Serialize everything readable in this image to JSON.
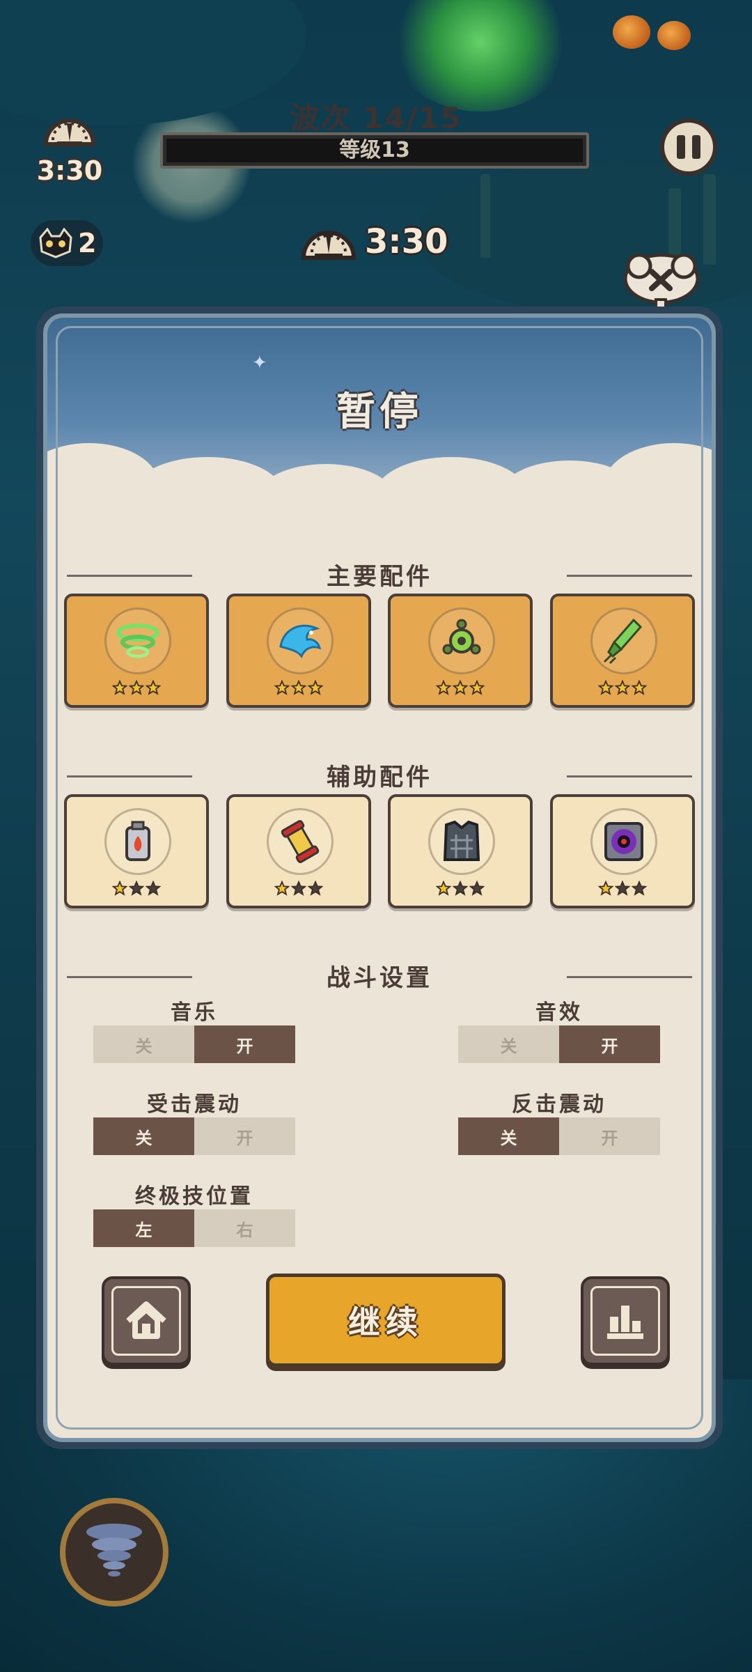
{
  "hud": {
    "speed_time": "3:30",
    "lives_count": "2",
    "wave_label": "波次  14/15",
    "level_label": "等级13",
    "center_time": "3:30"
  },
  "panel": {
    "title": "暂停",
    "main_parts_label": "主要配件",
    "aux_parts_label": "辅助配件",
    "battle_settings_label": "战斗设置",
    "main_parts": [
      {
        "name": "green-whirlwind-icon",
        "stars": 3
      },
      {
        "name": "blue-dragon-icon",
        "stars": 3
      },
      {
        "name": "green-orb-drone-icon",
        "stars": 3
      },
      {
        "name": "green-rocket-icon",
        "stars": 3
      }
    ],
    "aux_parts": [
      {
        "name": "fire-fuel-flask-icon",
        "stars": 1
      },
      {
        "name": "red-scroll-canister-icon",
        "stars": 1
      },
      {
        "name": "armor-vest-icon",
        "stars": 1
      },
      {
        "name": "black-hole-device-icon",
        "stars": 1
      }
    ],
    "colors": {
      "star_filled": "#f4c22c",
      "star_empty": "#4a3f3a",
      "main_card": "#e5a74f",
      "aux_card": "#f4e3bd",
      "continue_button": "#e7a52a"
    }
  },
  "settings": {
    "music": {
      "title": "音乐",
      "off": "关",
      "on": "开",
      "value": "开"
    },
    "sfx": {
      "title": "音效",
      "off": "关",
      "on": "开",
      "value": "开"
    },
    "hit_vibration": {
      "title": "受击震动",
      "off": "关",
      "on": "开",
      "value": "关"
    },
    "counter_vibration": {
      "title": "反击震动",
      "off": "关",
      "on": "开",
      "value": "关"
    },
    "ultimate_position": {
      "title": "终极技位置",
      "left": "左",
      "right": "右",
      "value": "左"
    }
  },
  "buttons": {
    "continue_label": "继续",
    "home_icon": "home-icon",
    "stats_icon": "leaderboard-icon"
  }
}
